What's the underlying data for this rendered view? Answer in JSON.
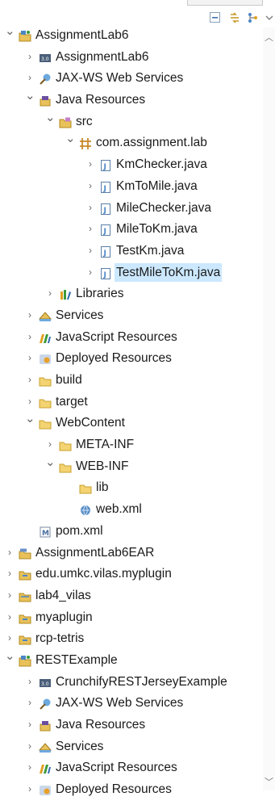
{
  "toolbar": {
    "buttons": [
      "collapse-all-icon",
      "link-with-editor-icon",
      "view-menu-icon"
    ]
  },
  "tree": [
    {
      "label": "AssignmentLab6",
      "level": 0,
      "expanded": true,
      "icon": "project-icon"
    },
    {
      "label": "AssignmentLab6",
      "level": 1,
      "expanded": false,
      "icon": "deployment-descriptor-icon"
    },
    {
      "label": "JAX-WS Web Services",
      "level": 1,
      "expanded": false,
      "icon": "web-services-icon"
    },
    {
      "label": "Java Resources",
      "level": 1,
      "expanded": true,
      "icon": "java-resources-icon"
    },
    {
      "label": "src",
      "level": 2,
      "expanded": true,
      "icon": "source-folder-icon"
    },
    {
      "label": "com.assignment.lab",
      "level": 3,
      "expanded": true,
      "icon": "package-icon"
    },
    {
      "label": "KmChecker.java",
      "level": 4,
      "expanded": false,
      "icon": "java-file-icon"
    },
    {
      "label": "KmToMile.java",
      "level": 4,
      "expanded": false,
      "icon": "java-file-icon"
    },
    {
      "label": "MileChecker.java",
      "level": 4,
      "expanded": false,
      "icon": "java-file-icon"
    },
    {
      "label": "MileToKm.java",
      "level": 4,
      "expanded": false,
      "icon": "java-file-icon"
    },
    {
      "label": "TestKm.java",
      "level": 4,
      "expanded": false,
      "icon": "java-file-icon"
    },
    {
      "label": "TestMileToKm.java",
      "level": 4,
      "expanded": false,
      "icon": "java-file-icon",
      "selected": true
    },
    {
      "label": "Libraries",
      "level": 2,
      "expanded": false,
      "icon": "libraries-icon"
    },
    {
      "label": "Services",
      "level": 1,
      "expanded": false,
      "icon": "services-icon"
    },
    {
      "label": "JavaScript Resources",
      "level": 1,
      "expanded": false,
      "icon": "javascript-resources-icon"
    },
    {
      "label": "Deployed Resources",
      "level": 1,
      "expanded": false,
      "icon": "deployed-resources-icon"
    },
    {
      "label": "build",
      "level": 1,
      "expanded": false,
      "icon": "folder-icon"
    },
    {
      "label": "target",
      "level": 1,
      "expanded": false,
      "icon": "folder-icon"
    },
    {
      "label": "WebContent",
      "level": 1,
      "expanded": true,
      "icon": "folder-icon"
    },
    {
      "label": "META-INF",
      "level": 2,
      "expanded": false,
      "icon": "folder-icon"
    },
    {
      "label": "WEB-INF",
      "level": 2,
      "expanded": true,
      "icon": "folder-icon"
    },
    {
      "label": "lib",
      "level": 3,
      "leaf": true,
      "icon": "folder-icon"
    },
    {
      "label": "web.xml",
      "level": 3,
      "leaf": true,
      "icon": "xml-file-icon"
    },
    {
      "label": "pom.xml",
      "level": 1,
      "leaf": true,
      "icon": "maven-pom-icon"
    },
    {
      "label": "AssignmentLab6EAR",
      "level": 0,
      "expanded": false,
      "icon": "ear-project-icon"
    },
    {
      "label": "edu.umkc.vilas.myplugin",
      "level": 0,
      "expanded": false,
      "icon": "plugin-project-icon"
    },
    {
      "label": "lab4_vilas",
      "level": 0,
      "expanded": false,
      "icon": "project-folder-icon"
    },
    {
      "label": "myaplugin",
      "level": 0,
      "expanded": false,
      "icon": "plugin-project-icon"
    },
    {
      "label": "rcp-tetris",
      "level": 0,
      "expanded": false,
      "icon": "plugin-project-icon"
    },
    {
      "label": "RESTExample",
      "level": 0,
      "expanded": true,
      "icon": "project-icon"
    },
    {
      "label": "CrunchifyRESTJerseyExample",
      "level": 1,
      "expanded": false,
      "icon": "deployment-descriptor-icon"
    },
    {
      "label": "JAX-WS Web Services",
      "level": 1,
      "expanded": false,
      "icon": "web-services-icon"
    },
    {
      "label": "Java Resources",
      "level": 1,
      "expanded": false,
      "icon": "java-resources-icon"
    },
    {
      "label": "Services",
      "level": 1,
      "expanded": false,
      "icon": "services-icon"
    },
    {
      "label": "JavaScript Resources",
      "level": 1,
      "expanded": false,
      "icon": "javascript-resources-icon"
    },
    {
      "label": "Deployed Resources",
      "level": 1,
      "expanded": false,
      "icon": "deployed-resources-icon"
    }
  ],
  "colors": {
    "selection": "#cce8ff",
    "folder": "#e8c15a",
    "java": "#4b86c5",
    "package": "#c8872a"
  }
}
